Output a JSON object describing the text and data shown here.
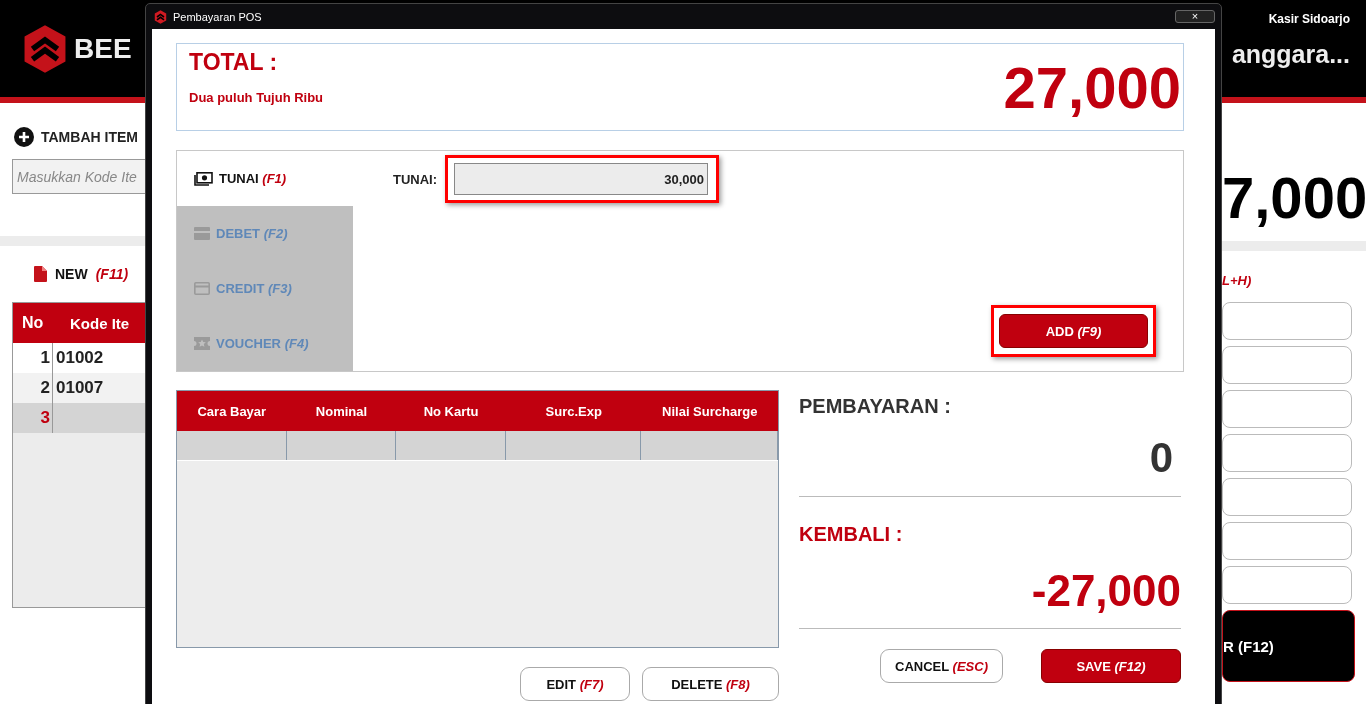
{
  "app": {
    "logo_text": "BEE",
    "user": "Kasir Sidoarjo",
    "customer_name": "anggara...",
    "add_item": {
      "label": "TAMBAH ITEM"
    },
    "item_code_field": {
      "placeholder": "Masukkan Kode Ite"
    },
    "new_button": {
      "label": "NEW",
      "shortcut": "(F11)"
    },
    "items_table": {
      "columns": [
        "No",
        "Kode Ite"
      ],
      "rows": [
        {
          "no": "1",
          "code": "01002",
          "selected": false
        },
        {
          "no": "2",
          "code": "01007",
          "selected": false
        },
        {
          "no": "3",
          "selected": true
        }
      ]
    },
    "total": "7,000",
    "shortcut_hint": "L+H)",
    "pay_button": "R (F12)"
  },
  "dialog": {
    "title": "Pembayaran POS",
    "close": "×",
    "total": {
      "label": "TOTAL :",
      "in_words": "Dua puluh Tujuh Ribu",
      "amount": "27,000"
    },
    "tabs": [
      {
        "kind": "cash",
        "label": "TUNAI",
        "shortcut": "(F1)",
        "selected": true,
        "disabled": false
      },
      {
        "kind": "debit",
        "label": "DEBET",
        "shortcut": "(F2)",
        "selected": false,
        "disabled": true
      },
      {
        "kind": "credit",
        "label": "CREDIT",
        "shortcut": "(F3)",
        "selected": false,
        "disabled": true
      },
      {
        "kind": "voucher",
        "label": "VOUCHER",
        "shortcut": "(F4)",
        "selected": false,
        "disabled": true
      }
    ],
    "cash_field": {
      "label": "TUNAI:",
      "value": "30,000"
    },
    "add_button": {
      "label": "ADD",
      "shortcut": "(F9)"
    },
    "payments_table": {
      "columns": [
        "Cara Bayar",
        "Nominal",
        "No Kartu",
        "Surc.Exp",
        "Nilai Surcharge"
      ]
    },
    "edit_button": {
      "label": "EDIT",
      "shortcut": "(F7)"
    },
    "delete_button": {
      "label": "DELETE",
      "shortcut": "(F8)"
    },
    "payment": {
      "label": "PEMBAYARAN :",
      "amount": "0"
    },
    "change": {
      "label": "KEMBALI :",
      "amount": "-27,000"
    },
    "cancel_button": {
      "label": "CANCEL",
      "shortcut": "(ESC)"
    },
    "save_button": {
      "label": "SAVE",
      "shortcut": "(F12)"
    }
  }
}
